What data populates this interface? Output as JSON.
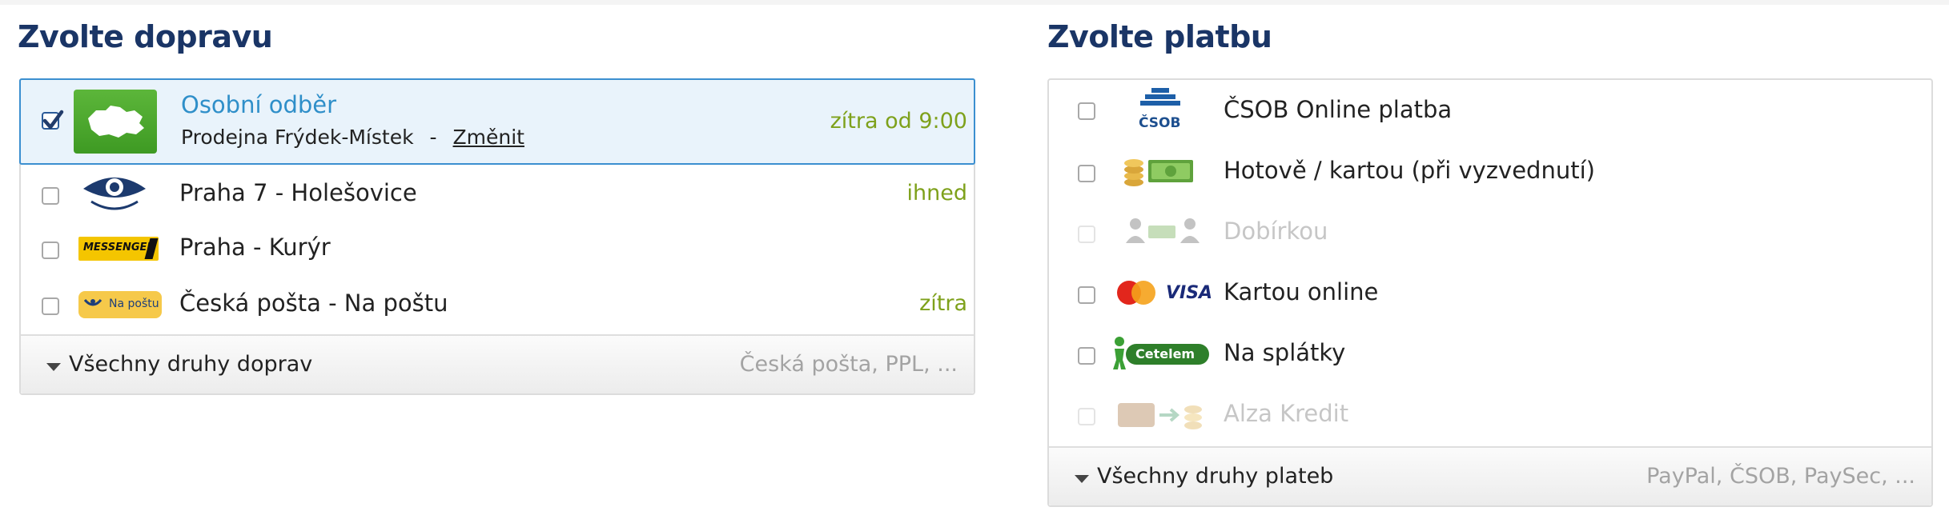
{
  "shipping": {
    "title": "Zvolte dopravu",
    "options": [
      {
        "label": "Osobní odběr",
        "store": "Prodejna Frýdek-Místek",
        "separator": "-",
        "change_link": "Změnit",
        "time": "zítra od 9:00",
        "checked": true,
        "icon": "czech-map-icon"
      },
      {
        "label": "Praha 7 - Holešovice",
        "time": "ihned",
        "checked": false,
        "icon": "showroom-eye-logo"
      },
      {
        "label": "Praha - Kurýr",
        "time": "",
        "checked": false,
        "icon": "messenger-logo",
        "logo_text": "MESSENGER"
      },
      {
        "label": "Česká pošta - Na poštu",
        "time": "zítra",
        "checked": false,
        "icon": "ceska-posta-logo",
        "logo_text": "Na poštu"
      }
    ],
    "footer": {
      "label": "Všechny druhy doprav",
      "hint": "Česká pošta, PPL, ..."
    }
  },
  "payment": {
    "title": "Zvolte platbu",
    "options": [
      {
        "label": "ČSOB Online platba",
        "disabled": false,
        "icon": "csob-logo",
        "logo_text": "ČSOB"
      },
      {
        "label": "Hotově / kartou (při vyzvednutí)",
        "disabled": false,
        "icon": "cash-coins-icon"
      },
      {
        "label": "Dobírkou",
        "disabled": true,
        "icon": "cash-on-delivery-icon"
      },
      {
        "label": "Kartou online",
        "disabled": false,
        "icon": "mastercard-visa-logo",
        "logo_text": "VISA"
      },
      {
        "label": "Na splátky",
        "disabled": false,
        "icon": "cetelem-logo",
        "logo_text": "Cetelem"
      },
      {
        "label": "Alza Kredit",
        "disabled": true,
        "icon": "alza-credit-icon"
      }
    ],
    "footer": {
      "label": "Všechny druhy plateb",
      "hint": "PayPal, ČSOB, PaySec, ..."
    }
  },
  "colors": {
    "title": "#1a3566",
    "selected_bg": "#e9f3fb",
    "selected_border": "#3b8fd0",
    "link_blue": "#2f8fc9",
    "time_green": "#7ea11b",
    "disabled_text": "#c6c6c6"
  }
}
